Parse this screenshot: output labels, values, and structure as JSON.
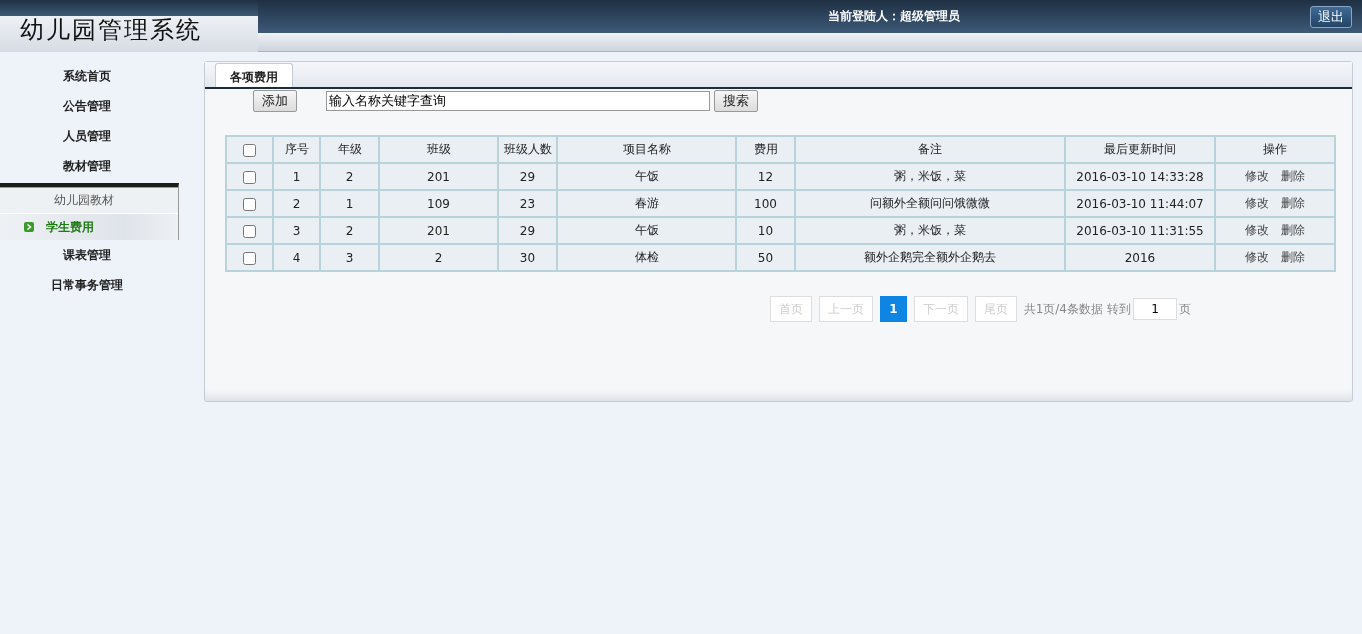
{
  "header": {
    "logo": "幼儿园管理系统",
    "login_label": "当前登陆人：",
    "login_user": "超级管理员",
    "logout": "退出"
  },
  "sidebar": {
    "items": [
      {
        "label": "系统首页",
        "selected": false
      },
      {
        "label": "公告管理",
        "selected": false
      },
      {
        "label": "人员管理",
        "selected": false
      },
      {
        "label": "教材管理",
        "selected": false,
        "expanded": true,
        "children": [
          {
            "label": "幼儿园教材",
            "selected": false
          },
          {
            "label": "学生费用",
            "selected": true
          }
        ]
      },
      {
        "label": "课表管理",
        "selected": false
      },
      {
        "label": "日常事务管理",
        "selected": false
      }
    ]
  },
  "tabs": [
    {
      "label": "各项费用",
      "selected": true
    }
  ],
  "toolbar": {
    "add": "添加",
    "search_value": "输入名称关键字查询",
    "search": "搜索"
  },
  "table": {
    "header_checked": false,
    "columns": [
      "序号",
      "年级",
      "班级",
      "班级人数",
      "项目名称",
      "费用",
      "备注",
      "最后更新时间",
      "操作"
    ],
    "rows": [
      {
        "checked": false,
        "cells": [
          "1",
          "2",
          "201",
          "29",
          "午饭",
          "12",
          "粥，米饭，菜",
          "2016-03-10 14:33:28"
        ],
        "actions": [
          "修改",
          "删除"
        ]
      },
      {
        "checked": false,
        "cells": [
          "2",
          "1",
          "109",
          "23",
          "春游",
          "100",
          "问额外全额问问饿微微",
          "2016-03-10 11:44:07"
        ],
        "actions": [
          "修改",
          "删除"
        ]
      },
      {
        "checked": false,
        "cells": [
          "3",
          "2",
          "201",
          "29",
          "午饭",
          "10",
          "粥，米饭，菜",
          "2016-03-10 11:31:55"
        ],
        "actions": [
          "修改",
          "删除"
        ]
      },
      {
        "checked": false,
        "cells": [
          "4",
          "3",
          "2",
          "30",
          "体检",
          "50",
          "额外企鹅完全额外企鹅去",
          "2016"
        ],
        "actions": [
          "修改",
          "删除"
        ]
      }
    ]
  },
  "pagination": {
    "first": {
      "label": "首页",
      "disabled": true
    },
    "prev": {
      "label": "上一页",
      "disabled": true
    },
    "pages": [
      {
        "label": "1",
        "selected": true
      }
    ],
    "next": {
      "label": "下一页",
      "disabled": true
    },
    "last": {
      "label": "尾页",
      "disabled": true
    },
    "summary": "共1页/4条数据",
    "goto_label": "转到",
    "goto_value": "1",
    "page_suffix": "页"
  }
}
